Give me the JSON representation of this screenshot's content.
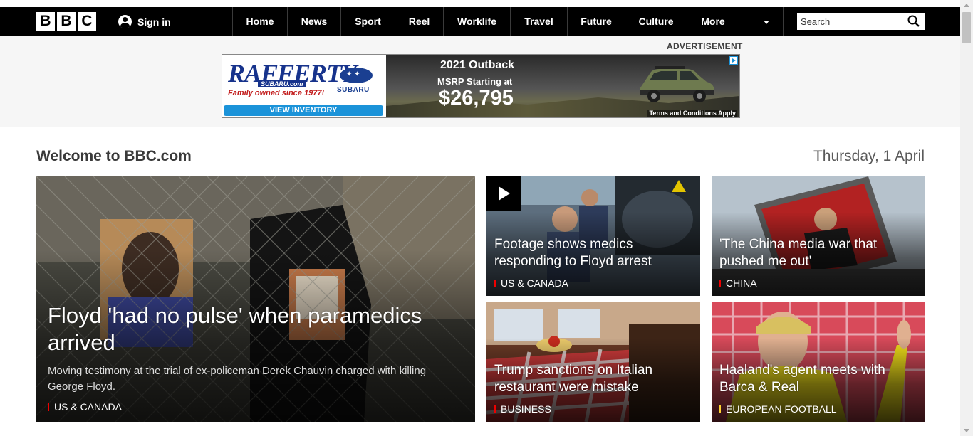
{
  "nav": {
    "logo": [
      "B",
      "B",
      "C"
    ],
    "signin": "Sign in",
    "items": [
      "Home",
      "News",
      "Sport",
      "Reel",
      "Worklife",
      "Travel",
      "Future",
      "Culture",
      "More"
    ],
    "search_placeholder": "Search"
  },
  "ad": {
    "label": "ADVERTISEMENT",
    "dealer": "RAFFERTY",
    "dealer_sub": "SUBARU.com",
    "family": "Family owned since 1977!",
    "brand": "SUBARU",
    "cta": "VIEW INVENTORY",
    "model": "2021 Outback",
    "msrp": "MSRP Starting at",
    "price": "$26,795",
    "terms": "Terms and Conditions Apply"
  },
  "main": {
    "welcome": "Welcome to BBC.com",
    "date": "Thursday, 1 April"
  },
  "stories": [
    {
      "headline": "Floyd 'had no pulse' when paramedics arrived",
      "summary": "Moving testimony at the trial of ex-policeman Derek Chauvin charged with killing George Floyd.",
      "tag": "US & CANADA"
    },
    {
      "headline": "Footage shows medics responding to Floyd arrest",
      "tag": "US & CANADA"
    },
    {
      "headline": "'The China media war that pushed me out'",
      "tag": "CHINA"
    },
    {
      "headline": "Trump sanctions on Italian restaurant were mistake",
      "tag": "BUSINESS"
    },
    {
      "headline": "Haaland's agent meets with Barca & Real",
      "tag": "EUROPEAN FOOTBALL"
    }
  ],
  "colors": {
    "nav_bg": "#000000",
    "news_tag": "#e00000",
    "sport_tag": "#ffd230",
    "ad_cta": "#1b93d9"
  }
}
